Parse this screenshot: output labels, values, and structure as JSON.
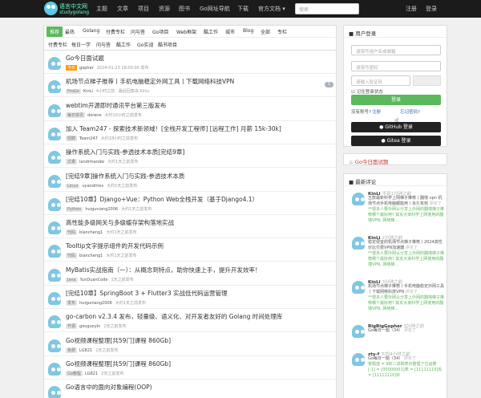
{
  "nav": {
    "logo_text": "语言中文网",
    "logo_sub": "studygolang",
    "items": [
      "主题",
      "文章",
      "项目",
      "资源",
      "图书",
      "Go网址导航",
      "下载",
      "官方文档 ▾"
    ],
    "search_placeholder": "搜索",
    "register": "注册",
    "login": "登录"
  },
  "tabs_row1": [
    "推荐",
    "最热",
    "Golang",
    "付费专栏",
    "问与答",
    "Go项目",
    "Web框架",
    "酷工作",
    "城市",
    "Blog",
    "全部",
    "专栏"
  ],
  "tabs_row2": [
    "付费专栏",
    "每日一学",
    "问与答",
    "酷工作",
    "Go实战",
    "酷书项目"
  ],
  "topics": [
    {
      "title": "Go今日面试题",
      "node": "今日",
      "node_orange": true,
      "author": "gopher",
      "time": "2024-01-23 18:00:00 发布",
      "count": ""
    },
    {
      "title": "机场节点梯子推荐丨手机电脑稳定外网工具丨下载网络科技VPN",
      "node": "ProGo",
      "node_orange": false,
      "author": "KinLi",
      "time": "4小时之前 · 最后回复由 KinLi",
      "count": "1"
    },
    {
      "title": "webtim开源即时通讯平台第三版发布",
      "node": "每日资讯",
      "node_orange": false,
      "author": "dorene",
      "time": "大约10小时之前发布",
      "count": ""
    },
    {
      "title": "加入 Team247 - 探索技术新领域！[全栈开发工程师] [远程工作] 月薪 15k-30k]",
      "node": "招聘",
      "node_orange": false,
      "author": "Team247",
      "time": "大约18小时之前发布",
      "count": ""
    },
    {
      "title": "操作系统入门与实践-参透技术本质[完结9章]",
      "node": "文章",
      "node_orange": false,
      "author": "landrmandw",
      "time": "大约1天之前发布",
      "count": ""
    },
    {
      "title": "[完结9章]操作系统入门与实践-参透技术本质",
      "node": "Linux",
      "node_orange": false,
      "author": "uyandrries",
      "time": "大约1天之前发布",
      "count": ""
    },
    {
      "title": "[完结10章】Django+Vue：Python Web全栈开发（基于Django4.1）",
      "node": "Python",
      "node_orange": false,
      "author": "huiguniang2006",
      "time": "大约1天之前发布",
      "count": ""
    },
    {
      "title": "高性能多级网关与多级缓存架构落地实战",
      "node": "代码",
      "node_orange": false,
      "author": "biancheng1",
      "time": "大约1天之前发布",
      "count": ""
    },
    {
      "title": "Tooltip文字提示组件的开发代码示例",
      "node": "代码",
      "node_orange": false,
      "author": "biancheng1",
      "time": "大约1天之前发布",
      "count": ""
    },
    {
      "title": "MyBatis实战指南（一）：从概念到特点，助你快速上手，提升开发效率！",
      "node": "Java",
      "node_orange": false,
      "author": "YunDuanCode",
      "time": "1天之前发布",
      "count": ""
    },
    {
      "title": "[完结10章】SpringBoot 3 + Flutter3 实战低代码运营管理",
      "node": "发布",
      "node_orange": false,
      "author": "huiguniang2006",
      "time": "大约1天之前发布",
      "count": ""
    },
    {
      "title": "go-carbon v2.3.4 发布，轻量级、语义化、对开发者友好的 Golang 时间处理库",
      "node": "开源",
      "node_orange": false,
      "author": "gouguoyin",
      "time": "2天之前发布",
      "count": ""
    },
    {
      "title": "Go视频课程整理[共59门]课程 860Gb]",
      "node": "免费",
      "node_orange": false,
      "author": "LG821",
      "time": "2天之前发布",
      "count": ""
    },
    {
      "title": "Go视频课程整理[共59门]课程 860Gb]",
      "node": "Go教程",
      "node_orange": false,
      "author": "LG821",
      "time": "2天之前发布",
      "count": ""
    },
    {
      "title": "Go语言中的面向对象编程(OOP)",
      "node": "",
      "node_orange": false,
      "author": "",
      "time": "",
      "count": ""
    }
  ],
  "login": {
    "title": "用户登录",
    "username_placeholder": "请填写用户名或邮箱",
    "password_placeholder": "请填写密码",
    "captcha_placeholder": "请输入验证码",
    "remember": "记住登录状态",
    "submit": "登录",
    "no_account": "没有账号?",
    "register": "注册",
    "forgot": "忘记密码?",
    "or": "或",
    "github": "GitHub 登录",
    "gitea": "Gitea 登录"
  },
  "today": {
    "title": "Go今日面试题"
  },
  "comments": {
    "title": "最新评论",
    "items": [
      {
        "user": "KinLi",
        "time": "不到1分钟之前",
        "text": "五款最新科学上网梯子推荐丨翻墙 vpn 机场节点手机电脑都能用丨永久有效",
        "tail": "评论了"
      },
      {
        "user": "KinLi",
        "time": "2分钟之前",
        "text": "稳定便宜的机场节点梯子推荐丨2024高性价比付费VPN加速器",
        "tail": "评论了"
      },
      {
        "user": "KinLi",
        "time": "3分钟之前",
        "text": "机场节点梯子推荐丨手机电脑稳定外网工具丨下载网络科技VPN",
        "tail": "评论了"
      },
      {
        "user": "BigBigGopher",
        "time": "3分钟之前",
        "text": "Go每日一题（34）",
        "tail": "评论了"
      },
      {
        "user": "zty-f",
        "time": "大约4小时之前",
        "text": "Go每日一题（34）",
        "tail": "评论了"
      }
    ],
    "replies": [
      "**很多人要外网认分享上外网的翻墙梯子推荐哪个最好用? 其实大家科学上网使用的翻墙VPN, 网络梯...",
      "**很多人要外网认分享上外网的翻墙梯子推荐哪个最好用? 其实大家科学上网使用的翻墙VPN, 网络梯...",
      "**很多人要外网认分享上外网的翻墙梯子推荐哪个最好用? 其实大家科学上网使用的翻墙VPN, 网络梯...",
      "",
      "答题值 = 9的二进制表示整理了位运算 [-1] = [00000001]表 = [11111110]反 = [11111110]补"
    ]
  }
}
